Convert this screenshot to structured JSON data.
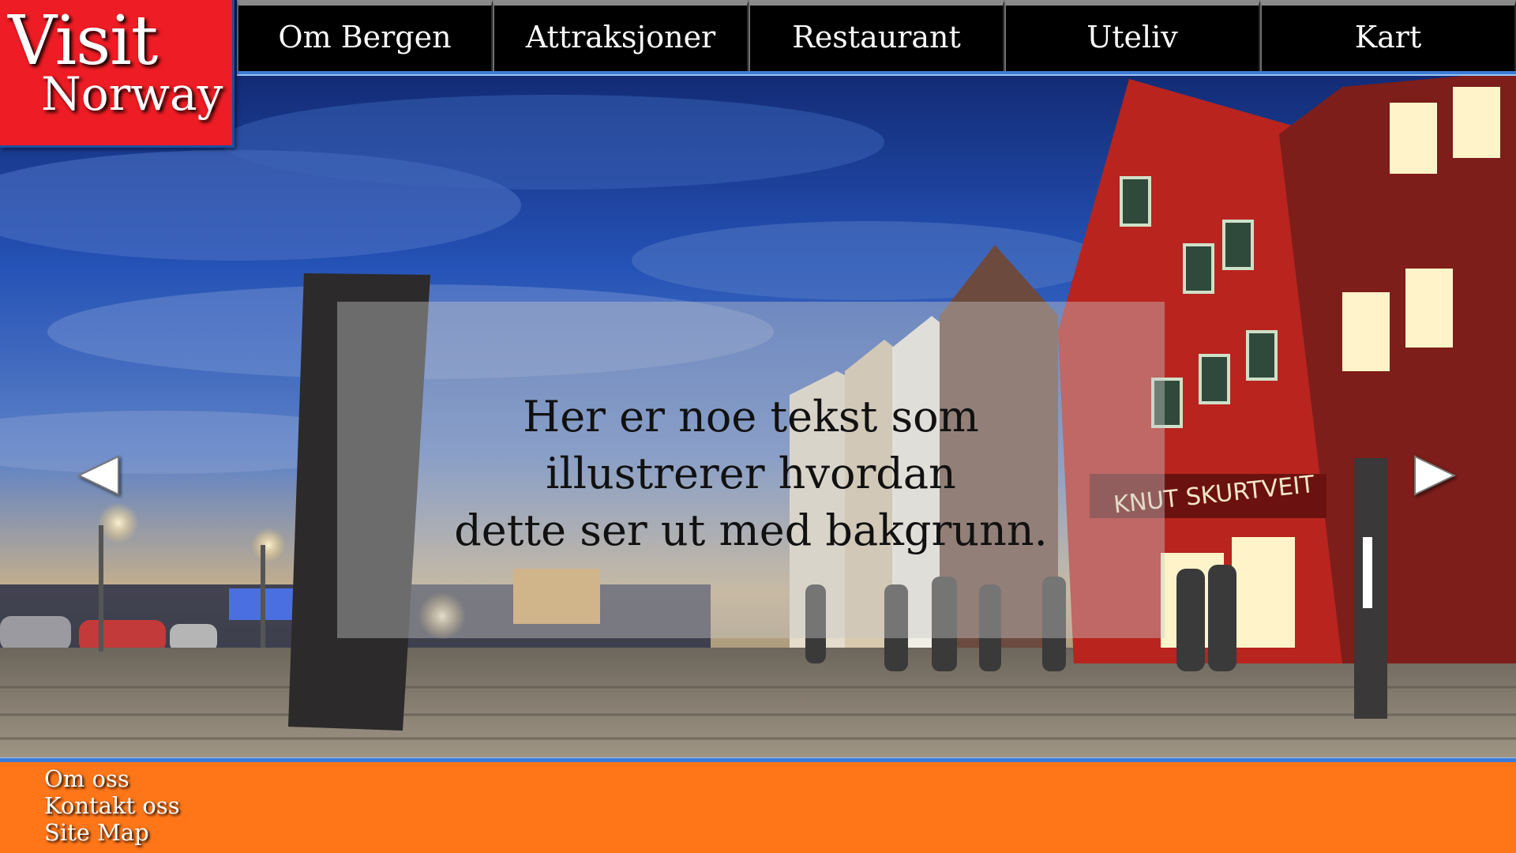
{
  "logo": {
    "line1": "Visit",
    "line2": "Norway"
  },
  "nav": {
    "items": [
      {
        "label": "Om Bergen"
      },
      {
        "label": "Attraksjoner"
      },
      {
        "label": "Restaurant"
      },
      {
        "label": "Uteliv"
      },
      {
        "label": "Kart"
      }
    ]
  },
  "hero": {
    "image": "bryggen-night-photo",
    "overlay_lines": [
      "Her er noe tekst som",
      "illustrerer hvordan",
      "dette ser ut med bakgrunn."
    ],
    "prev_icon": "arrow-left-icon",
    "next_icon": "arrow-right-icon"
  },
  "footer": {
    "links": [
      {
        "label": "Om oss"
      },
      {
        "label": "Kontakt oss"
      },
      {
        "label": "Site Map"
      }
    ]
  },
  "colors": {
    "logo_bg": "#ee1c24",
    "nav_bg": "#000000",
    "accent_line": "#3a7bd5",
    "footer_bg": "#ff7619"
  }
}
